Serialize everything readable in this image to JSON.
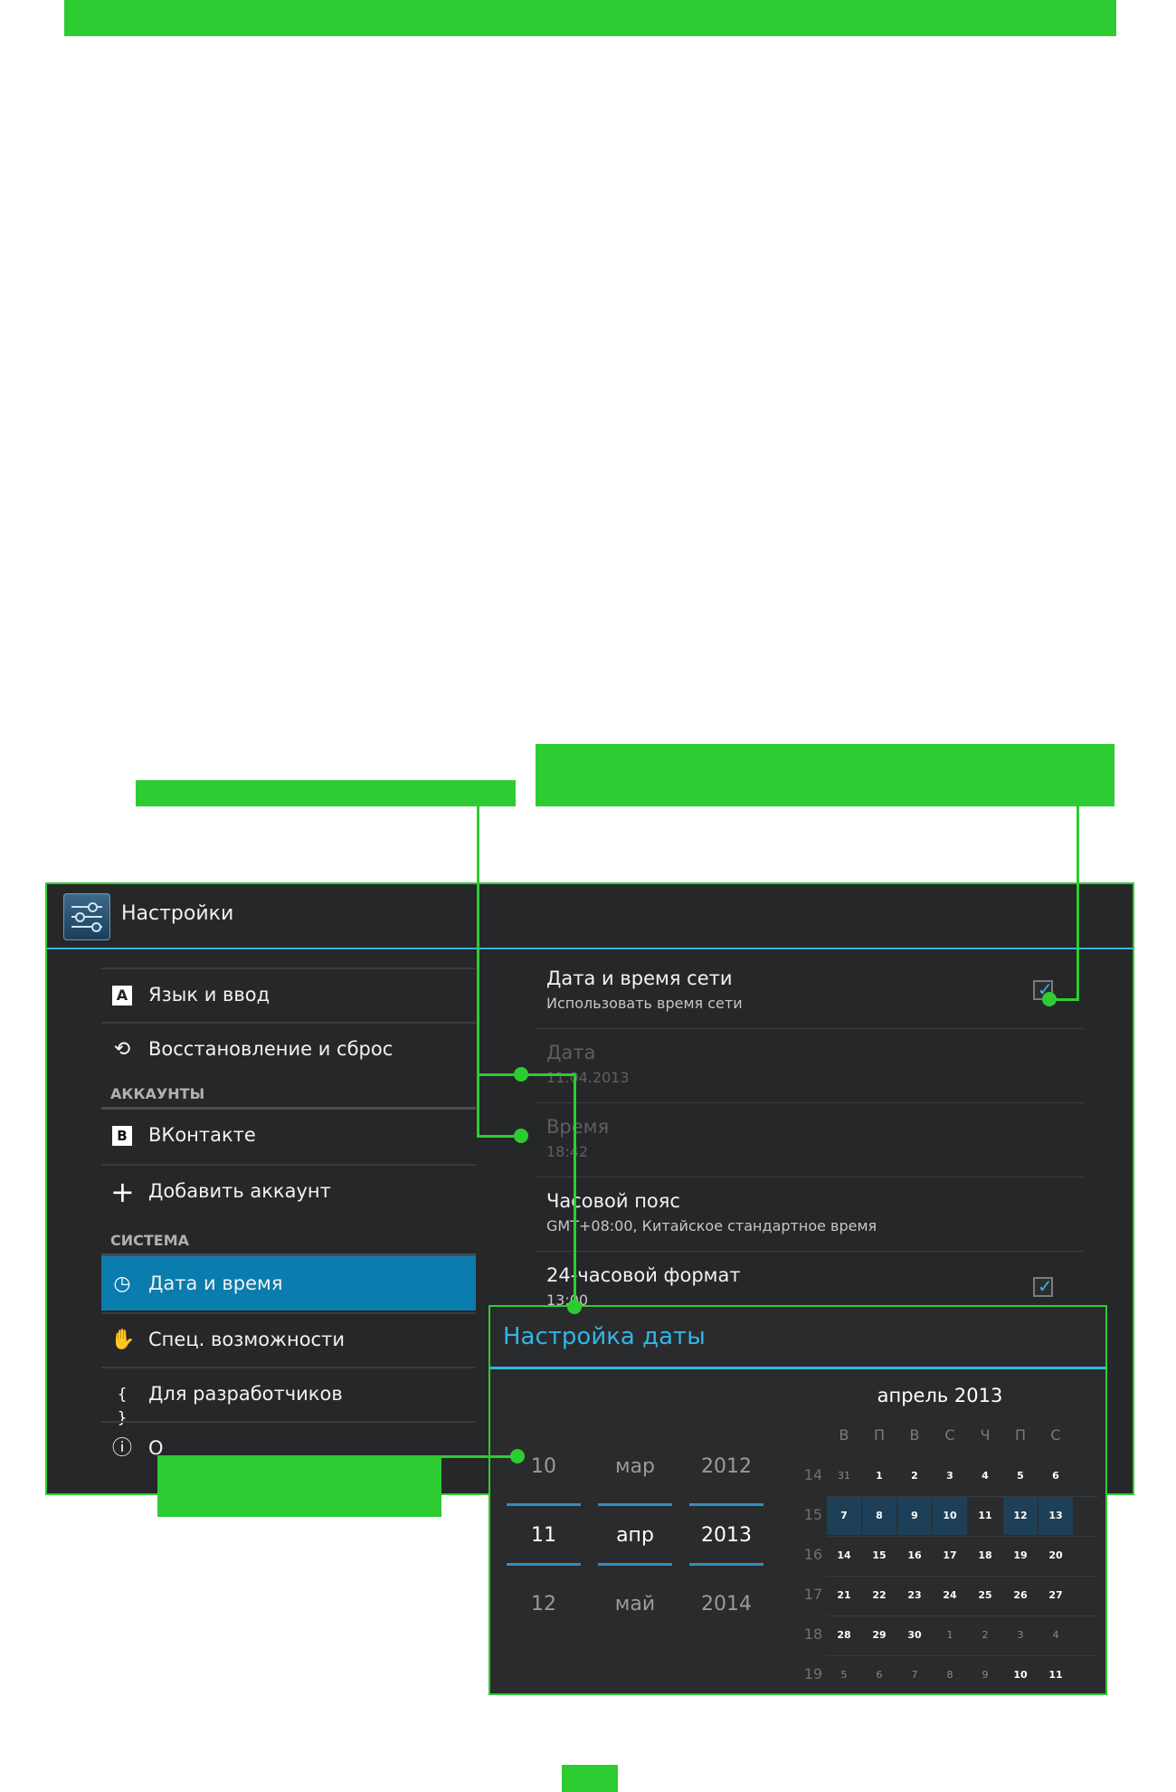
{
  "app": {
    "title": "Настройки"
  },
  "sidebar": {
    "items": [
      {
        "id": "lang",
        "label": "Язык и ввод",
        "icon": "A"
      },
      {
        "id": "reset",
        "label": "Восстановление и сброс",
        "icon": "⟲"
      },
      {
        "id": "vk",
        "label": "ВКонтакте",
        "icon": "B"
      },
      {
        "id": "add",
        "label": "Добавить аккаунт",
        "icon": "+"
      },
      {
        "id": "datetime",
        "label": "Дата и время",
        "icon": "◷"
      },
      {
        "id": "access",
        "label": "Спец. возможности",
        "icon": "✋"
      },
      {
        "id": "dev",
        "label": "Для разработчиков",
        "icon": "{ }"
      },
      {
        "id": "about",
        "label": "О",
        "icon": "ⓘ"
      }
    ],
    "headers": {
      "accounts": "АККАУНТЫ",
      "system": "СИСТЕМА"
    }
  },
  "settings": {
    "network": {
      "title": "Дата и время сети",
      "summary": "Использовать время сети"
    },
    "date": {
      "title": "Дата",
      "summary": "11.04.2013"
    },
    "time": {
      "title": "Время",
      "summary": "18:42"
    },
    "timezone": {
      "title": "Часовой пояс",
      "summary": "GMT+08:00, Китайское стандартное время"
    },
    "format24": {
      "title": "24-часовой формат",
      "summary": "13:00"
    }
  },
  "dialog": {
    "title": "Настройка даты",
    "picker": {
      "day": [
        "10",
        "11",
        "12"
      ],
      "month": [
        "мар",
        "апр",
        "май"
      ],
      "year": [
        "2012",
        "2013",
        "2014"
      ]
    },
    "calendar": {
      "month_label": "апрель 2013",
      "weekdays": [
        "В",
        "П",
        "В",
        "С",
        "Ч",
        "П",
        "С"
      ],
      "weeks": [
        {
          "num": "14",
          "days": [
            "31",
            "1",
            "2",
            "3",
            "4",
            "5",
            "6"
          ]
        },
        {
          "num": "15",
          "days": [
            "7",
            "8",
            "9",
            "10",
            "11",
            "12",
            "13"
          ]
        },
        {
          "num": "16",
          "days": [
            "14",
            "15",
            "16",
            "17",
            "18",
            "19",
            "20"
          ]
        },
        {
          "num": "17",
          "days": [
            "21",
            "22",
            "23",
            "24",
            "25",
            "26",
            "27"
          ]
        },
        {
          "num": "18",
          "days": [
            "28",
            "29",
            "30",
            "1",
            "2",
            "3",
            "4"
          ]
        },
        {
          "num": "19",
          "days": [
            "5",
            "6",
            "7",
            "8",
            "9",
            "10",
            "11"
          ]
        }
      ]
    }
  },
  "colors": {
    "accent": "#33b5e5",
    "callout": "#2ecc33",
    "selected": "#0a7cad"
  }
}
